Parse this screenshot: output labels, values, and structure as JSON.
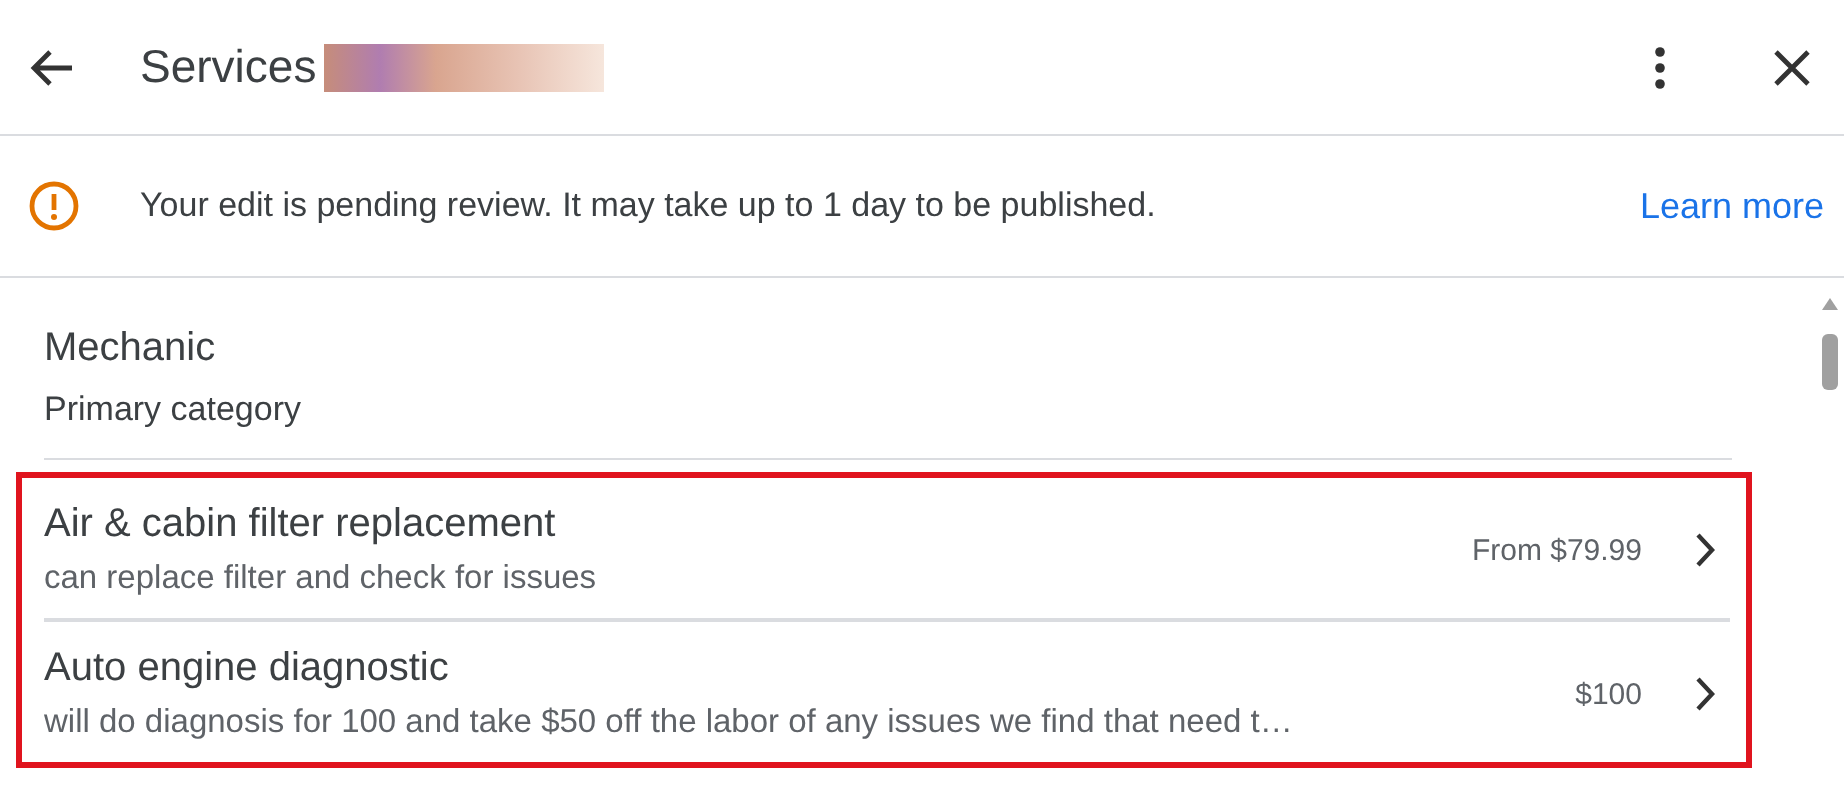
{
  "header": {
    "title": "Services",
    "name_redacted": true
  },
  "notice": {
    "message": "Your edit is pending review. It may take up to 1 day to be published.",
    "link": "Learn more"
  },
  "category": {
    "name": "Mechanic",
    "label": "Primary category"
  },
  "services": {
    "highlighted": true,
    "items": [
      {
        "name": "Air & cabin filter replacement",
        "description": "can replace filter and check for issues",
        "price": "From $79.99"
      },
      {
        "name": "Auto engine diagnostic",
        "description": "will do diagnosis for 100 and take $50 off the labor of any issues we find that need t…",
        "price": "$100"
      }
    ]
  }
}
